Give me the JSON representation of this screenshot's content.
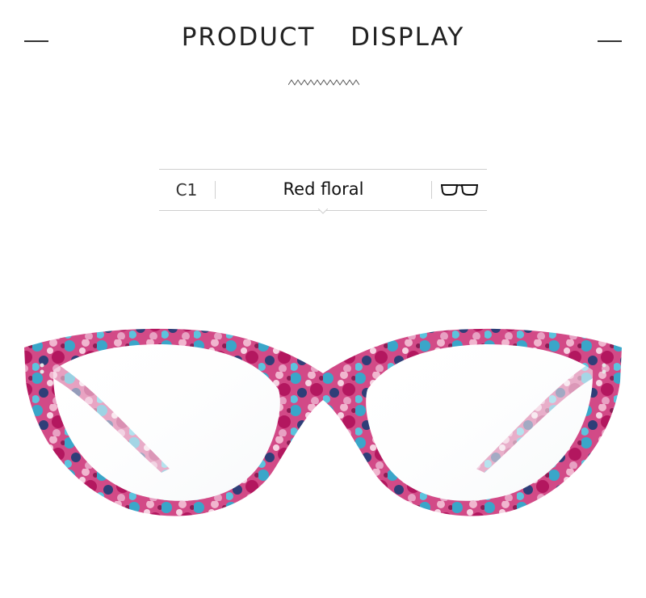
{
  "header": {
    "title": "PRODUCT  DISPLAY"
  },
  "variant": {
    "code": "C1",
    "color_name": "Red floral",
    "icon": "eyeglasses-icon"
  },
  "product_image": {
    "description_icon": "cat-eye-glasses-floral-frame"
  },
  "colors": {
    "frame_pink": "#c81e6e",
    "frame_blue": "#3aa6c9",
    "frame_light": "#f1b6cf",
    "frame_navy": "#2f3e78",
    "line": "#cfcfcf"
  }
}
